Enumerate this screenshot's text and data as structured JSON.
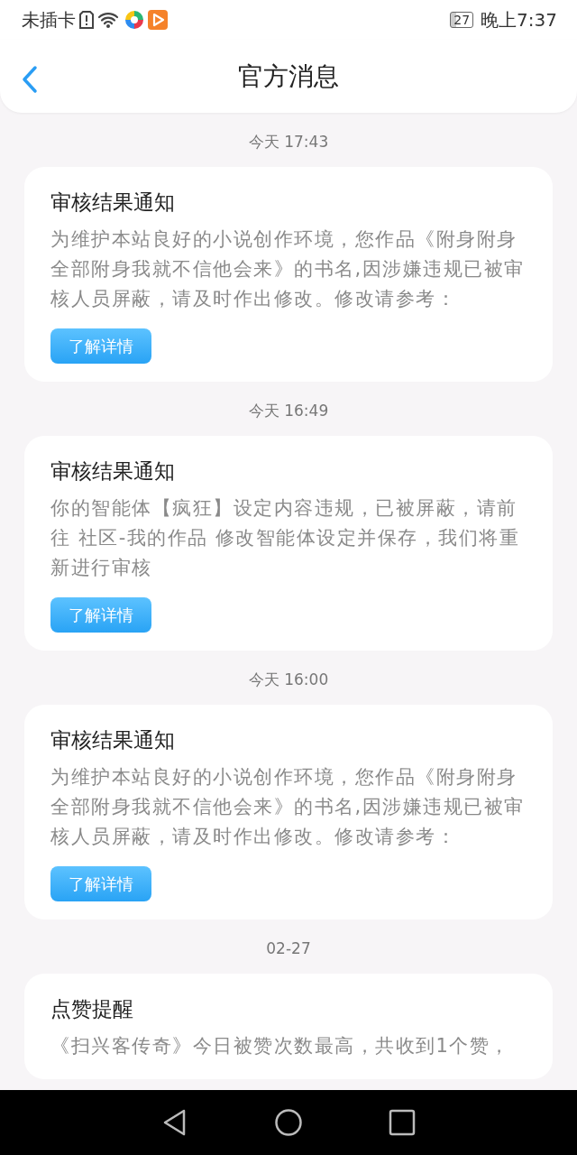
{
  "status_bar": {
    "carrier": "未插卡",
    "battery": "27",
    "time": "晚上7:37"
  },
  "header": {
    "title": "官方消息"
  },
  "messages": [
    {
      "time": "今天 17:43",
      "title": "审核结果通知",
      "body": "为维护本站良好的小说创作环境，您作品《附身附身全部附身我就不信他会来》的书名,因涉嫌违规已被审核人员屏蔽，请及时作出修改。修改请参考：",
      "button": "了解详情"
    },
    {
      "time": "今天 16:49",
      "title": "审核结果通知",
      "body": "你的智能体【疯狂】设定内容违规，已被屏蔽，请前往 社区-我的作品 修改智能体设定并保存，我们将重新进行审核",
      "button": "了解详情"
    },
    {
      "time": "今天 16:00",
      "title": "审核结果通知",
      "body": "为维护本站良好的小说创作环境，您作品《附身附身全部附身我就不信他会来》的书名,因涉嫌违规已被审核人员屏蔽，请及时作出修改。修改请参考：",
      "button": "了解详情"
    },
    {
      "time": "02-27",
      "title": "点赞提醒",
      "body": "《扫兴客传奇》今日被赞次数最高，共收到1个赞，"
    }
  ]
}
